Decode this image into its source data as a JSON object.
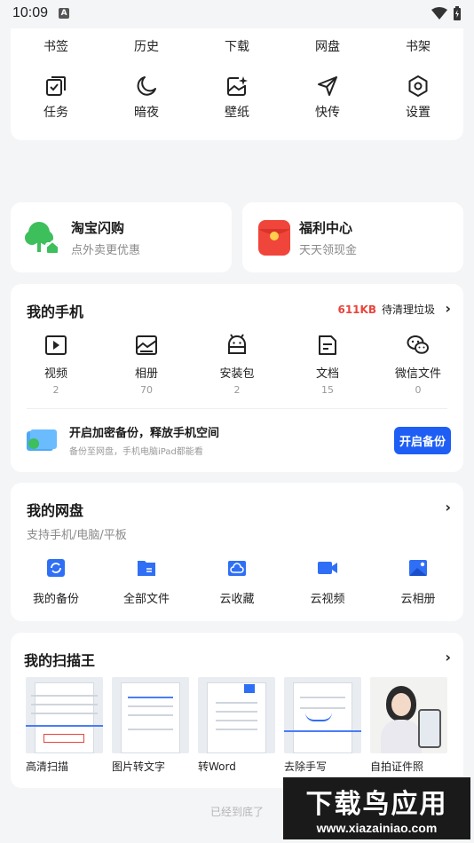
{
  "status_bar": {
    "time": "10:09"
  },
  "top_card": {
    "row1": [
      "书签",
      "历史",
      "下载",
      "网盘",
      "书架"
    ],
    "row2": [
      {
        "label": "任务",
        "icon": "task-icon"
      },
      {
        "label": "暗夜",
        "icon": "moon-icon"
      },
      {
        "label": "壁纸",
        "icon": "wallpaper-icon"
      },
      {
        "label": "快传",
        "icon": "paper-plane-icon"
      },
      {
        "label": "设置",
        "icon": "settings-icon"
      }
    ]
  },
  "promos": {
    "left": {
      "title": "淘宝闪购",
      "sub": "点外卖更优惠",
      "icon": "tree-icon"
    },
    "right": {
      "title": "福利中心",
      "sub": "天天领现金",
      "icon": "red-envelope-icon"
    }
  },
  "phone": {
    "title": "我的手机",
    "junk_size": "611KB",
    "junk_label": "待清理垃圾",
    "items": [
      {
        "label": "视频",
        "count": "2",
        "icon": "video-icon"
      },
      {
        "label": "相册",
        "count": "70",
        "icon": "album-icon"
      },
      {
        "label": "安装包",
        "count": "2",
        "icon": "android-icon"
      },
      {
        "label": "文档",
        "count": "15",
        "icon": "document-icon"
      },
      {
        "label": "微信文件",
        "count": "0",
        "icon": "wechat-icon"
      }
    ],
    "backup_title": "开启加密备份，释放手机空间",
    "backup_sub": "备份至网盘，手机电脑iPad都能看",
    "backup_button": "开启备份"
  },
  "cloud": {
    "title": "我的网盘",
    "sub": "支持手机/电脑/平板",
    "items": [
      {
        "label": "我的备份",
        "icon": "backup-icon"
      },
      {
        "label": "全部文件",
        "icon": "folder-icon"
      },
      {
        "label": "云收藏",
        "icon": "cloud-collect-icon"
      },
      {
        "label": "云视频",
        "icon": "cloud-video-icon"
      },
      {
        "label": "云相册",
        "icon": "cloud-album-icon"
      }
    ]
  },
  "scan": {
    "title": "我的扫描王",
    "items": [
      "高清扫描",
      "图片转文字",
      "转Word",
      "去除手写",
      "自拍证件照"
    ]
  },
  "footer": "已经到底了",
  "watermark": {
    "line1": "下载鸟应用",
    "line2": "www.xiazainiao.com"
  },
  "colors": {
    "accent": "#1e5ef5",
    "junk": "#e8453c",
    "green": "#3dbf5c",
    "red": "#e8453c"
  }
}
